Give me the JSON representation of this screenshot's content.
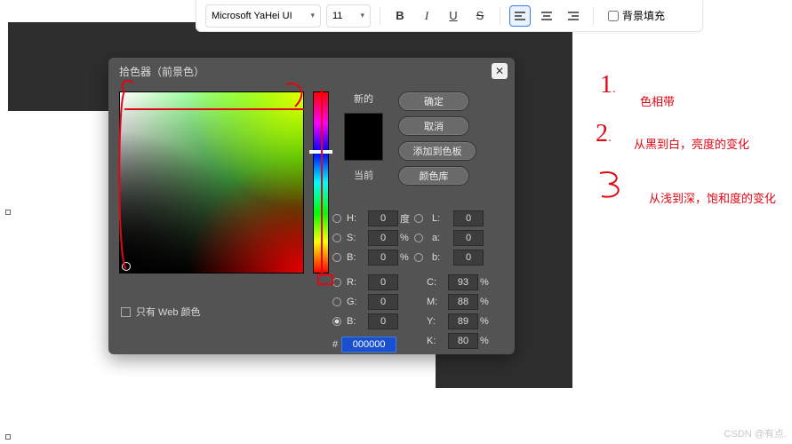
{
  "toolbar": {
    "font": "Microsoft YaHei UI",
    "size": "11",
    "bold": "B",
    "italic": "I",
    "underline": "U",
    "strike": "S",
    "bg_fill_label": "背景填充"
  },
  "dialog": {
    "title": "拾色器（前景色）",
    "new_label": "新的",
    "current_label": "当前",
    "btn_ok": "确定",
    "btn_cancel": "取消",
    "btn_add": "添加到色板",
    "btn_lib": "颜色库",
    "web_only": "只有 Web 颜色",
    "hex_prefix": "#",
    "hex_value": "000000",
    "fields": {
      "H": {
        "label": "H:",
        "value": "0",
        "unit": "度"
      },
      "S": {
        "label": "S:",
        "value": "0",
        "unit": "%"
      },
      "Bv": {
        "label": "B:",
        "value": "0",
        "unit": "%"
      },
      "R": {
        "label": "R:",
        "value": "0",
        "unit": ""
      },
      "G": {
        "label": "G:",
        "value": "0",
        "unit": ""
      },
      "Bb": {
        "label": "B:",
        "value": "0",
        "unit": ""
      },
      "L": {
        "label": "L:",
        "value": "0",
        "unit": ""
      },
      "a": {
        "label": "a:",
        "value": "0",
        "unit": ""
      },
      "b": {
        "label": "b:",
        "value": "0",
        "unit": ""
      },
      "C": {
        "label": "C:",
        "value": "93",
        "unit": "%"
      },
      "M": {
        "label": "M:",
        "value": "88",
        "unit": "%"
      },
      "Y": {
        "label": "Y:",
        "value": "89",
        "unit": "%"
      },
      "K": {
        "label": "K:",
        "value": "80",
        "unit": "%"
      }
    }
  },
  "notes": {
    "n1": "色相带",
    "n2": "从黑到白，亮度的变化",
    "n3": "从浅到深，饱和度的变化"
  },
  "watermark": "CSDN @有点."
}
